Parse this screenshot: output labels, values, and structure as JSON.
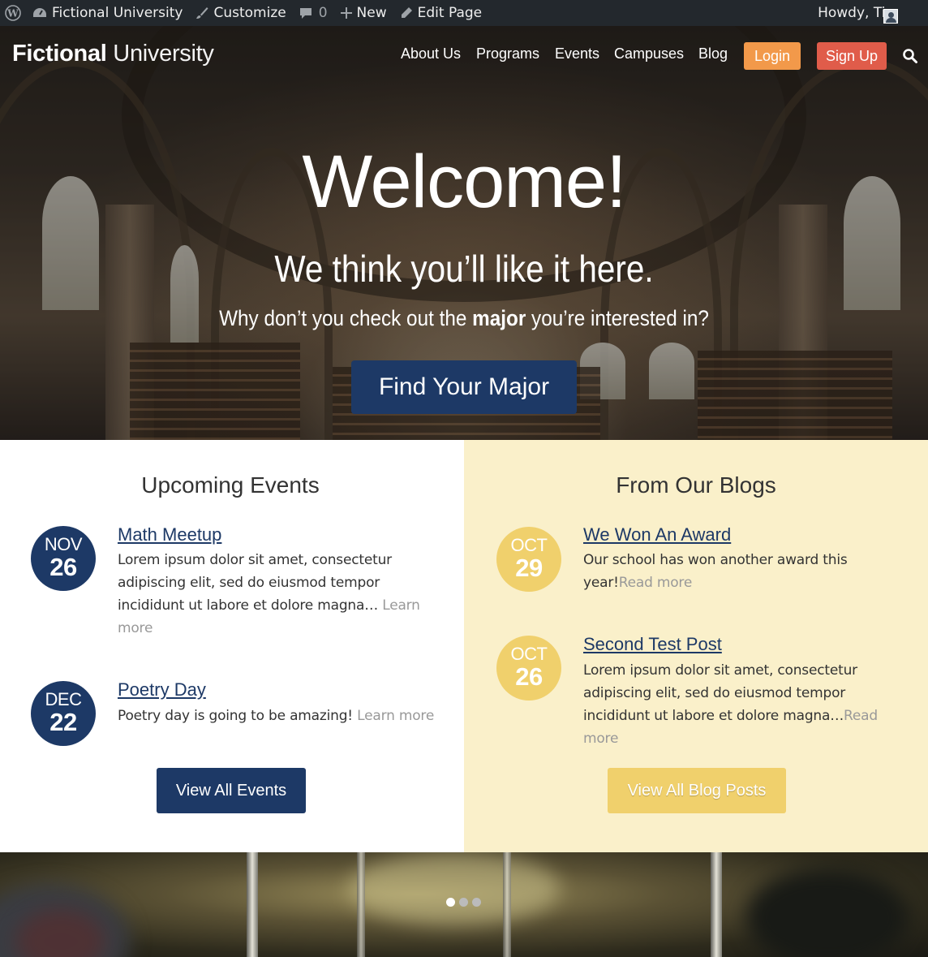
{
  "admin_bar": {
    "site_name": "Fictional University",
    "customize": "Customize",
    "comments_count": "0",
    "new": "New",
    "edit_page": "Edit Page",
    "howdy": "Howdy, Tim",
    "icons": [
      "wordpress-icon",
      "dashboard-icon",
      "brush-icon",
      "comment-icon",
      "plus-icon",
      "pencil-icon",
      "avatar"
    ]
  },
  "header": {
    "logo_bold": "Fictional",
    "logo_light": "University",
    "nav": [
      "About Us",
      "Programs",
      "Events",
      "Campuses",
      "Blog"
    ],
    "login": "Login",
    "signup": "Sign Up",
    "search_icon": "search-icon"
  },
  "hero": {
    "welcome": "Welcome!",
    "subtitle": "We think you’ll like it here.",
    "question_start": "Why don’t you check out the ",
    "question_bold": "major",
    "question_end": " you’re interested in?",
    "button": "Find Your Major"
  },
  "events": {
    "title": "Upcoming Events",
    "items": [
      {
        "month": "NOV",
        "day": "26",
        "title": "Math Meetup",
        "text": "Lorem ipsum dolor sit amet, consectetur adipiscing elit, sed do eiusmod tempor incididunt ut labore et dolore magna… ",
        "more": "Learn more"
      },
      {
        "month": "DEC",
        "day": "22",
        "title": "Poetry Day",
        "text": "Poetry day is going to be amazing! ",
        "more": "Learn more"
      }
    ],
    "button": "View All Events"
  },
  "blogs": {
    "title": "From Our Blogs",
    "items": [
      {
        "month": "OCT",
        "day": "29",
        "title": "We Won An Award",
        "text": "Our school has won another award this year!",
        "more": "Read more"
      },
      {
        "month": "OCT",
        "day": "26",
        "title": "Second Test Post",
        "text": "Lorem ipsum dolor sit amet, consectetur adipiscing elit, sed do eiusmod tempor incididunt ut labore et dolore magna…",
        "more": "Read more"
      }
    ],
    "button": "View All Blog Posts"
  },
  "slider": {
    "dots": 3,
    "active_dot": 1
  },
  "colors": {
    "navy": "#1d3966",
    "gold": "#f0d06c",
    "cream": "#faf0ca",
    "login_orange": "#f2994a",
    "signup_red": "#e05c4a",
    "admin_bar": "#23282d"
  }
}
